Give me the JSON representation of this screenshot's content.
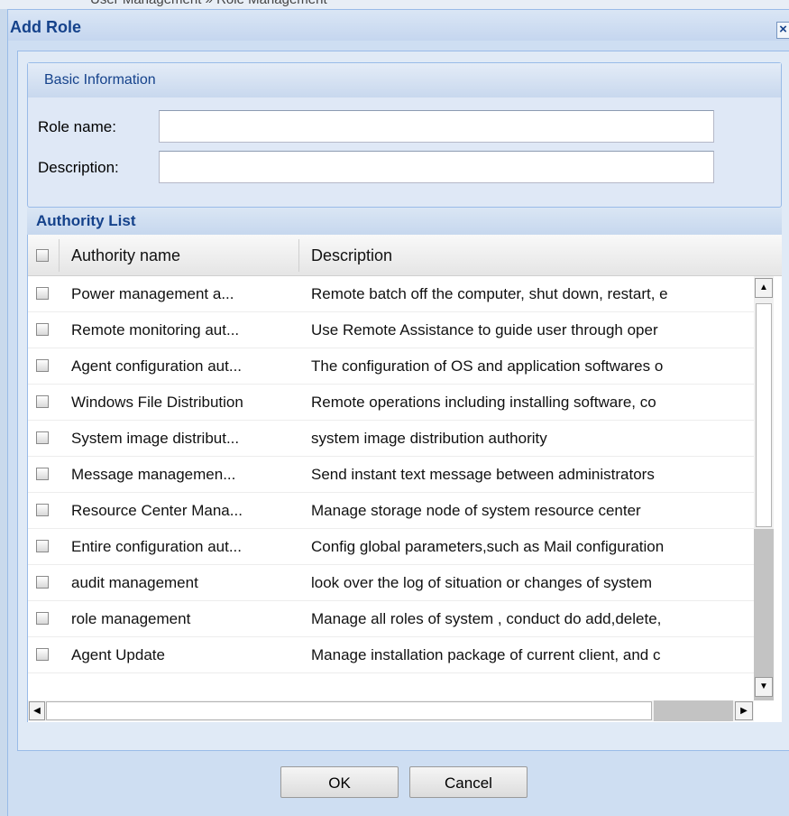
{
  "background": {
    "breadcrumb": "User Management » Role Management"
  },
  "dialog": {
    "title": "Add Role",
    "close_icon": "×"
  },
  "basic_info": {
    "legend": "Basic Information",
    "role_name_label": "Role name:",
    "role_name_value": "",
    "description_label": "Description:",
    "description_value": ""
  },
  "authority_list": {
    "title": "Authority List",
    "columns": [
      "Authority name",
      "Description"
    ],
    "rows": [
      {
        "name": "Power management a...",
        "description": "Remote batch off the computer, shut down, restart, e"
      },
      {
        "name": "Remote monitoring aut...",
        "description": "Use Remote Assistance to guide user through oper"
      },
      {
        "name": "Agent configuration aut...",
        "description": "The configuration of OS and application softwares o"
      },
      {
        "name": "Windows File Distribution",
        "description": "Remote operations including installing software, co"
      },
      {
        "name": "System image distribut...",
        "description": "system image distribution authority"
      },
      {
        "name": "Message managemen...",
        "description": "Send instant text message between administrators"
      },
      {
        "name": "Resource Center Mana...",
        "description": "Manage storage node of system resource center"
      },
      {
        "name": "Entire configuration aut...",
        "description": "Config global parameters,such as Mail configuration"
      },
      {
        "name": "audit management",
        "description": "look over the log of situation or changes of system"
      },
      {
        "name": "role management",
        "description": "Manage all roles of system , conduct do add,delete,"
      },
      {
        "name": "Agent Update",
        "description": "Manage installation package of current client, and c"
      }
    ]
  },
  "scroll_icons": {
    "up": "▲",
    "down": "▼",
    "left": "◀",
    "right": "▶"
  },
  "buttons": {
    "ok": "OK",
    "cancel": "Cancel"
  },
  "colors": {
    "title_text": "#15428b",
    "panel_border": "#99bbe8",
    "dialog_bg": "#cedef2"
  }
}
